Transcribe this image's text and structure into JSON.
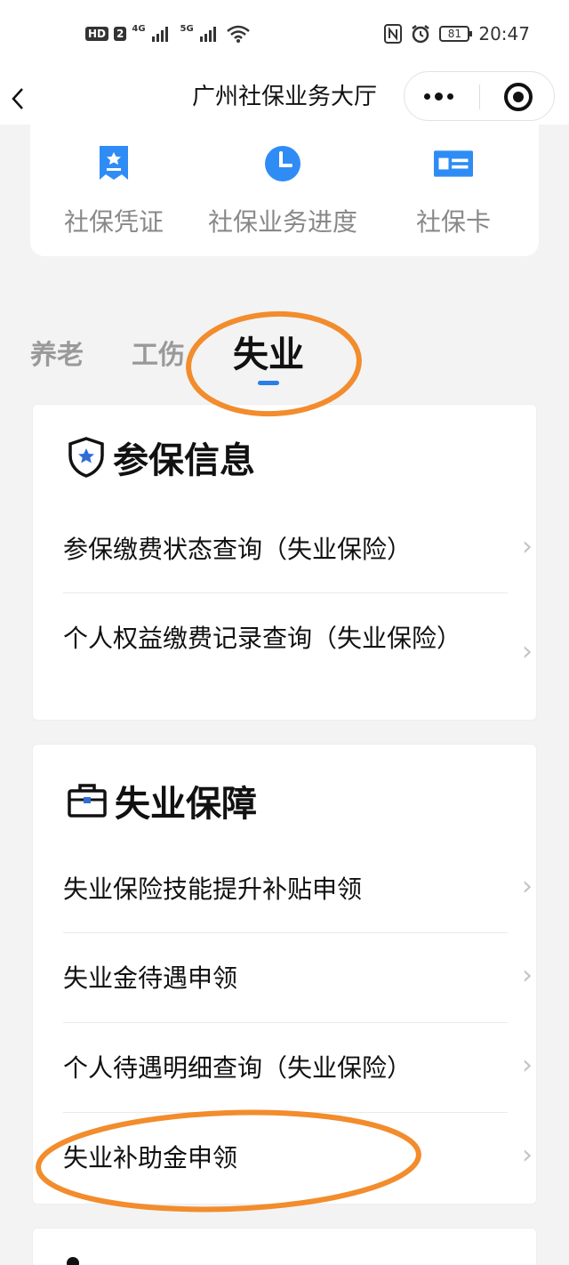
{
  "status_bar": {
    "left_badge": "HD",
    "left_badge2": "2",
    "net1": "4G",
    "net2": "5G",
    "battery": "81",
    "time": "20:47"
  },
  "navbar": {
    "title": "广州社保业务大厅",
    "back_icon": "chevron-left-icon",
    "more_icon": "more-dots-icon",
    "close_icon": "target-circle-icon"
  },
  "quick_entries": [
    {
      "label": "社保凭证",
      "icon": "certificate-bookmark-icon",
      "color": "#2f8cf5"
    },
    {
      "label": "社保业务进度",
      "icon": "clock-icon",
      "color": "#2f8cf5"
    },
    {
      "label": "社保卡",
      "icon": "card-icon",
      "color": "#2f8cf5"
    }
  ],
  "tabs": [
    {
      "label": "养老",
      "active": false
    },
    {
      "label": "工伤",
      "active": false
    },
    {
      "label": "失业",
      "active": true
    }
  ],
  "sections": {
    "insured_info": {
      "title": "参保信息",
      "icon": "shield-star-icon",
      "items": [
        "参保缴费状态查询（失业保险）",
        "个人权益缴费记录查询（失业保险）"
      ]
    },
    "unemployment": {
      "title": "失业保障",
      "icon": "briefcase-icon",
      "items": [
        "失业保险技能提升补贴申领",
        "失业金待遇申领",
        "个人待遇明细查询（失业保险）",
        "失业补助金申领"
      ]
    }
  },
  "colors": {
    "accent": "#2b7de9",
    "annotation": "#f28c2c"
  }
}
